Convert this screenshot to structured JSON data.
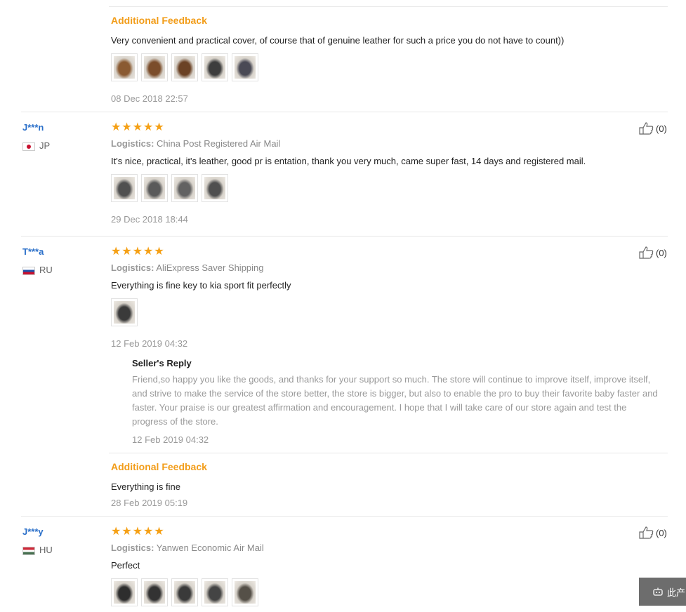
{
  "reviews": [
    {
      "additional_label": "Additional Feedback",
      "text": "Very convenient and practical cover, of course that of genuine leather for such a price you do not have to count))",
      "photos": [
        {
          "icon": "leather-key-case-photo",
          "color": "#8a5a32"
        },
        {
          "icon": "leather-key-case-photo",
          "color": "#7b4d2b"
        },
        {
          "icon": "leather-key-case-photo",
          "color": "#6b4225"
        },
        {
          "icon": "leather-key-case-photo",
          "color": "#3d3d3d"
        },
        {
          "icon": "leather-key-case-photo",
          "color": "#4a4a55"
        }
      ],
      "date": "08 Dec 2018 22:57"
    },
    {
      "user": "J***n",
      "country": "JP",
      "stars": "★★★★★",
      "logistics_label": "Logistics:",
      "logistics": "China Post Registered Air Mail",
      "text": "It's nice, practical, it's leather, good pr is entation, thank you very much, came super fast, 14 days and registered mail.",
      "photos": [
        {
          "icon": "leather-key-case-photo",
          "color": "#505050"
        },
        {
          "icon": "leather-key-case-photo",
          "color": "#5a5a5a"
        },
        {
          "icon": "leather-key-case-photo",
          "color": "#626262"
        },
        {
          "icon": "leather-key-case-photo",
          "color": "#4f4f4f"
        }
      ],
      "date": "29 Dec 2018 18:44",
      "likes": "(0)"
    },
    {
      "user": "T***a",
      "country": "RU",
      "stars": "★★★★★",
      "logistics_label": "Logistics:",
      "logistics": "AliExpress Saver Shipping",
      "text": "Everything is fine key to kia sport fit perfectly",
      "photos": [
        {
          "icon": "leather-key-case-photo",
          "color": "#3a3a3a"
        }
      ],
      "date": "12 Feb 2019 04:32",
      "likes": "(0)",
      "seller_reply_title": "Seller's Reply",
      "seller_reply": "Friend,so happy you like the goods, and thanks for your support so much. The store will continue to improve itself, improve itself, and strive to make the service of the store better, the store is bigger, but also to enable the pro to buy their favorite baby faster and faster. Your praise is our greatest affirmation and encouragement. I hope that I will take care of our store again and test the progress of the store.",
      "seller_reply_date": "12 Feb 2019 04:32",
      "additional_label": "Additional Feedback",
      "additional_text": "Everything is fine",
      "additional_date": "28 Feb 2019 05:19"
    },
    {
      "user": "J***y",
      "country": "HU",
      "stars": "★★★★★",
      "logistics_label": "Logistics:",
      "logistics": "Yanwen Economic Air Mail",
      "text": "Perfect",
      "photos": [
        {
          "icon": "leather-key-case-photo",
          "color": "#2e2e2e"
        },
        {
          "icon": "leather-key-case-photo",
          "color": "#333333"
        },
        {
          "icon": "leather-key-case-photo",
          "color": "#3a3a3a"
        },
        {
          "icon": "leather-key-case-photo",
          "color": "#444444"
        },
        {
          "icon": "leather-key-case-photo",
          "color": "#555048"
        }
      ],
      "likes": "(0)"
    }
  ],
  "side_button": {
    "label": "此产",
    "icon": "robot-chat-icon"
  },
  "colors": {
    "accent": "#f29d1a",
    "username": "#2a6fc9",
    "star": "#f5a015"
  }
}
